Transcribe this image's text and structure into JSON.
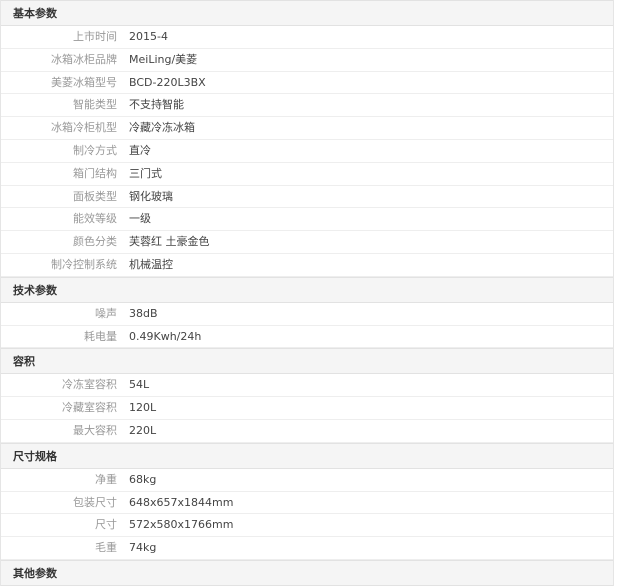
{
  "sections": [
    {
      "title": "基本参数",
      "rows": [
        {
          "label": "上市时间",
          "value": "2015-4"
        },
        {
          "label": "冰箱冰柜品牌",
          "value": "MeiLing/美菱"
        },
        {
          "label": "美菱冰箱型号",
          "value": "BCD-220L3BX"
        },
        {
          "label": "智能类型",
          "value": "不支持智能"
        },
        {
          "label": "冰箱冷柜机型",
          "value": "冷藏冷冻冰箱"
        },
        {
          "label": "制冷方式",
          "value": "直冷"
        },
        {
          "label": "箱门结构",
          "value": "三门式"
        },
        {
          "label": "面板类型",
          "value": "钢化玻璃"
        },
        {
          "label": "能效等级",
          "value": "一级"
        },
        {
          "label": "颜色分类",
          "value": "芙蓉红 土豪金色"
        },
        {
          "label": "制冷控制系统",
          "value": "机械温控"
        }
      ]
    },
    {
      "title": "技术参数",
      "rows": [
        {
          "label": "噪声",
          "value": "38dB"
        },
        {
          "label": "耗电量",
          "value": "0.49Kwh/24h"
        }
      ]
    },
    {
      "title": "容积",
      "rows": [
        {
          "label": "冷冻室容积",
          "value": "54L"
        },
        {
          "label": "冷藏室容积",
          "value": "120L"
        },
        {
          "label": "最大容积",
          "value": "220L"
        }
      ]
    },
    {
      "title": "尺寸规格",
      "rows": [
        {
          "label": "净重",
          "value": "68kg"
        },
        {
          "label": "包装尺寸",
          "value": "648x657x1844mm"
        },
        {
          "label": "尺寸",
          "value": "572x580x1766mm"
        },
        {
          "label": "毛重",
          "value": "74kg"
        }
      ]
    },
    {
      "title": "其他参数",
      "rows": []
    }
  ]
}
